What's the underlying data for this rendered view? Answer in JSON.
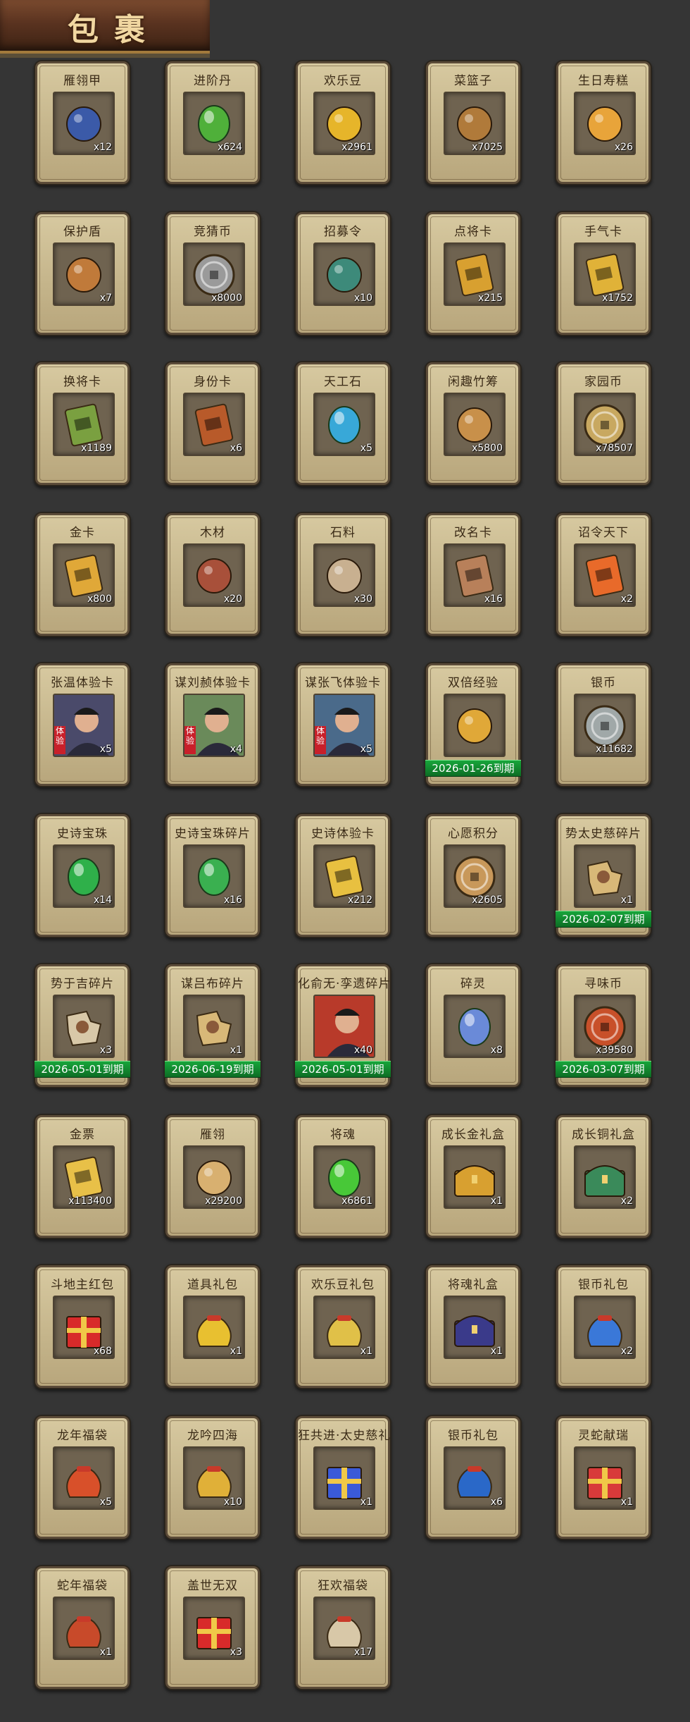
{
  "header": {
    "title": "包裹"
  },
  "items": [
    {
      "name": "雁翎甲",
      "qty": "x12",
      "icon": "armor-icon",
      "color": "#3b5aa8"
    },
    {
      "name": "进阶丹",
      "qty": "x624",
      "icon": "green-pill-icon",
      "color": "#4fb03a"
    },
    {
      "name": "欢乐豆",
      "qty": "x2961",
      "icon": "gold-beans-icon",
      "color": "#e6b52a"
    },
    {
      "name": "菜篮子",
      "qty": "x7025",
      "icon": "basket-icon",
      "color": "#b07a3a"
    },
    {
      "name": "生日寿糕",
      "qty": "x26",
      "icon": "birthday-cake-icon",
      "color": "#e8a43a"
    },
    {
      "name": "保护盾",
      "qty": "x7",
      "icon": "shield-icon",
      "color": "#c07a3a"
    },
    {
      "name": "竞猜币",
      "qty": "x8000",
      "icon": "silver-coin-icon",
      "color": "#9a9a9a"
    },
    {
      "name": "招募令",
      "qty": "x10",
      "icon": "recruit-token-icon",
      "color": "#3d8a7a"
    },
    {
      "name": "点将卡",
      "qty": "x215",
      "icon": "general-card-icon",
      "color": "#d8a030"
    },
    {
      "name": "手气卡",
      "qty": "x1752",
      "icon": "luck-card-icon",
      "color": "#e0b238"
    },
    {
      "name": "换将卡",
      "qty": "x1189",
      "icon": "swap-card-icon",
      "color": "#7aa040"
    },
    {
      "name": "身份卡",
      "qty": "x6",
      "icon": "identity-card-icon",
      "color": "#b85a2a"
    },
    {
      "name": "天工石",
      "qty": "x5",
      "icon": "blue-crystal-icon",
      "color": "#38a8d8"
    },
    {
      "name": "闲趣竹筹",
      "qty": "x5800",
      "icon": "bamboo-token-icon",
      "color": "#c8904a"
    },
    {
      "name": "家园币",
      "qty": "x78507",
      "icon": "home-coin-icon",
      "color": "#c8a860"
    },
    {
      "name": "金卡",
      "qty": "x800",
      "icon": "gold-card-icon",
      "color": "#e0a838"
    },
    {
      "name": "木材",
      "qty": "x20",
      "icon": "wood-icon",
      "color": "#a8503a"
    },
    {
      "name": "石料",
      "qty": "x30",
      "icon": "stone-icon",
      "color": "#c8b090"
    },
    {
      "name": "改名卡",
      "qty": "x16",
      "icon": "rename-card-icon",
      "color": "#b8805a"
    },
    {
      "name": "诏令天下",
      "qty": "x2",
      "icon": "edict-scroll-icon",
      "color": "#e86a2a"
    },
    {
      "name": "张温体验卡",
      "qty": "x5",
      "icon": "portrait-zhangwen-icon",
      "color": "#4a4a6a",
      "trial": true
    },
    {
      "name": "谋刘赪体验卡",
      "qty": "x4",
      "icon": "portrait-liucheng-icon",
      "color": "#6a8a5a",
      "trial": true
    },
    {
      "name": "谋张飞体验卡",
      "qty": "x5",
      "icon": "portrait-zhangfei-icon",
      "color": "#4a6a8a",
      "trial": true
    },
    {
      "name": "双倍经验",
      "qty": "",
      "icon": "double-exp-icon",
      "color": "#e0a838",
      "expiry": "2026-01-26到期"
    },
    {
      "name": "银币",
      "qty": "x11682",
      "icon": "silver-coins-icon",
      "color": "#a0a8a8"
    },
    {
      "name": "史诗宝珠",
      "qty": "x14",
      "icon": "green-orb-icon",
      "color": "#2fb04a"
    },
    {
      "name": "史诗宝珠碎片",
      "qty": "x16",
      "icon": "green-shard-icon",
      "color": "#3ab050"
    },
    {
      "name": "史诗体验卡",
      "qty": "x212",
      "icon": "epic-trial-card-icon",
      "color": "#e8c040"
    },
    {
      "name": "心愿积分",
      "qty": "x2605",
      "icon": "wish-coin-icon",
      "color": "#c8985a"
    },
    {
      "name": "势太史慈碎片",
      "qty": "x1",
      "icon": "puzzle-fragment-icon",
      "color": "#d8b878",
      "expiry": "2026-02-07到期"
    },
    {
      "name": "势于吉碎片",
      "qty": "x3",
      "icon": "puzzle-fragment-icon",
      "color": "#d8c8a8",
      "expiry": "2026-05-01到期"
    },
    {
      "name": "谋吕布碎片",
      "qty": "x1",
      "icon": "puzzle-fragment-icon",
      "color": "#d8b878",
      "expiry": "2026-06-19到期"
    },
    {
      "name": "化俞无·孪遗碎片",
      "qty": "x40",
      "icon": "portrait-hero-icon",
      "color": "#b83a2a",
      "expiry": "2026-05-01到期"
    },
    {
      "name": "碎灵",
      "qty": "x8",
      "icon": "spirit-crystal-icon",
      "color": "#6a8ad8"
    },
    {
      "name": "寻味币",
      "qty": "x39580",
      "icon": "taste-coin-icon",
      "color": "#c8502a",
      "expiry": "2026-03-07到期"
    },
    {
      "name": "金票",
      "qty": "x113400",
      "icon": "gold-ticket-icon",
      "color": "#e8c048"
    },
    {
      "name": "雁翎",
      "qty": "x29200",
      "icon": "feather-icon",
      "color": "#d8b070"
    },
    {
      "name": "将魂",
      "qty": "x6861",
      "icon": "green-soul-icon",
      "color": "#48c838"
    },
    {
      "name": "成长金礼盒",
      "qty": "x1",
      "icon": "gold-chest-icon",
      "color": "#d8a030"
    },
    {
      "name": "成长铜礼盒",
      "qty": "x2",
      "icon": "bronze-chest-icon",
      "color": "#3a8a5a"
    },
    {
      "name": "斗地主红包",
      "qty": "x68",
      "icon": "red-envelope-icon",
      "color": "#d82a2a"
    },
    {
      "name": "道具礼包",
      "qty": "x1",
      "icon": "gold-bag-icon",
      "color": "#e8c030"
    },
    {
      "name": "欢乐豆礼包",
      "qty": "x1",
      "icon": "gold-bag-icon",
      "color": "#e0c048"
    },
    {
      "name": "将魂礼盒",
      "qty": "x1",
      "icon": "blue-chest-icon",
      "color": "#3a3a8a"
    },
    {
      "name": "银币礼包",
      "qty": "x2",
      "icon": "blue-bag-icon",
      "color": "#3a78d8"
    },
    {
      "name": "龙年福袋",
      "qty": "x5",
      "icon": "lucky-bag-icon",
      "color": "#d8502a"
    },
    {
      "name": "龙吟四海",
      "qty": "x10",
      "icon": "gold-bag-icon",
      "color": "#e0b038"
    },
    {
      "name": "狂共进·太史慈礼",
      "qty": "x1",
      "icon": "gift-box-icon",
      "color": "#3a5ad8"
    },
    {
      "name": "银币礼包",
      "qty": "x6",
      "icon": "blue-bag-icon",
      "color": "#2a68c8"
    },
    {
      "name": "灵蛇献瑞",
      "qty": "x1",
      "icon": "red-gift-icon",
      "color": "#d83a3a"
    },
    {
      "name": "蛇年福袋",
      "qty": "x1",
      "icon": "lucky-bag-icon",
      "color": "#c84a2a"
    },
    {
      "name": "盖世无双",
      "qty": "x3",
      "icon": "red-gift-icon",
      "color": "#d82a2a"
    },
    {
      "name": "狂欢福袋",
      "qty": "x17",
      "icon": "lucky-bag-icon",
      "color": "#d8c8a8"
    }
  ]
}
